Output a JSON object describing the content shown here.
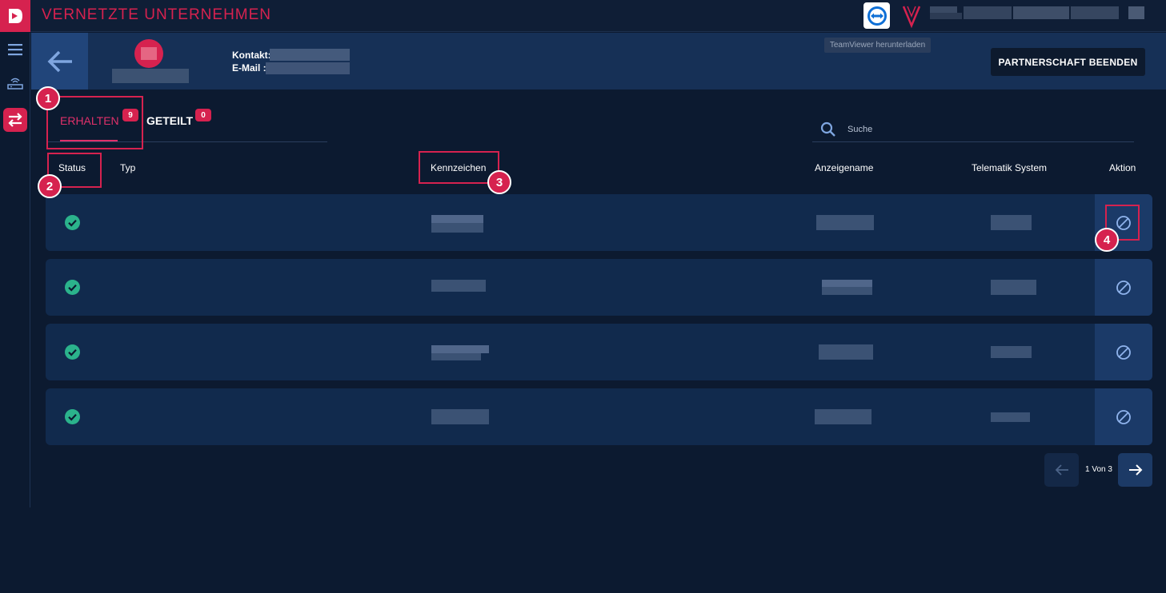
{
  "app": {
    "title": "VERNETZTE UNTERNEHMEN",
    "brand_color": "#d6224f"
  },
  "header": {
    "contact_label": "Kontakt:",
    "email_label": "E-Mail :",
    "teamviewer_download": "TeamViewer herunterladen",
    "end_partnership": "PARTNERSCHAFT BEENDEN"
  },
  "tabs": [
    {
      "label": "ERHALTEN",
      "badge": "9",
      "active": true
    },
    {
      "label": "GETEILT",
      "badge": "0",
      "active": false
    }
  ],
  "search": {
    "placeholder": "Suche"
  },
  "columns": {
    "status": "Status",
    "type": "Typ",
    "plate": "Kennzeichen",
    "display_name": "Anzeigename",
    "telematics": "Telematik System",
    "action": "Aktion"
  },
  "rows": [
    {
      "status": "ok"
    },
    {
      "status": "ok"
    },
    {
      "status": "ok"
    },
    {
      "status": "ok"
    }
  ],
  "pagination": {
    "label": "1 Von 3"
  },
  "annotations": [
    "1",
    "2",
    "3",
    "4"
  ],
  "icons": {
    "status": "check-circle-icon",
    "action": "block-icon"
  }
}
